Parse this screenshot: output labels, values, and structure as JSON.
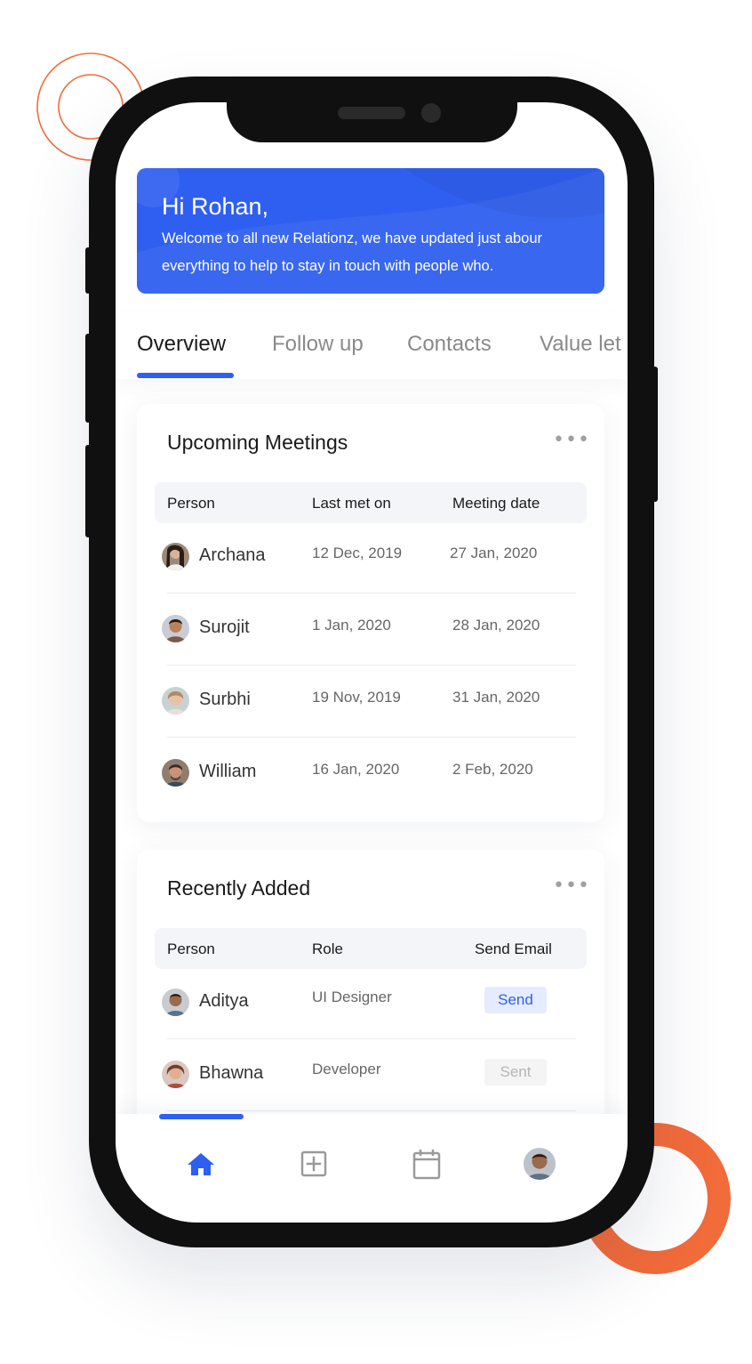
{
  "colors": {
    "accent": "#2f5ff0",
    "decor_orange": "#f26b3a",
    "phone_frame": "#101010"
  },
  "banner": {
    "greeting": "Hi Rohan,",
    "message": "Welcome to all new Relationz, we have updated just abour everything to help to stay in touch with people who."
  },
  "tabs": [
    {
      "label": "Overview",
      "active": true
    },
    {
      "label": "Follow up",
      "active": false
    },
    {
      "label": "Contacts",
      "active": false
    },
    {
      "label": "Value let",
      "active": false
    }
  ],
  "upcoming": {
    "title": "Upcoming Meetings",
    "more_icon": "more-horizontal-icon",
    "columns": [
      "Person",
      "Last met on",
      "Meeting date"
    ],
    "rows": [
      {
        "name": "Archana",
        "last_met": "12 Dec, 2019",
        "meeting": "27 Jan, 2020"
      },
      {
        "name": "Surojit",
        "last_met": "1 Jan, 2020",
        "meeting": "28 Jan, 2020"
      },
      {
        "name": "Surbhi",
        "last_met": "19 Nov, 2019",
        "meeting": "31 Jan, 2020"
      },
      {
        "name": "William",
        "last_met": "16 Jan, 2020",
        "meeting": "2 Feb, 2020"
      }
    ]
  },
  "recent": {
    "title": "Recently Added",
    "more_icon": "more-horizontal-icon",
    "columns": [
      "Person",
      "Role",
      "Send Email"
    ],
    "rows": [
      {
        "name": "Aditya",
        "role": "UI Designer",
        "action": "Send",
        "sent": false
      },
      {
        "name": "Bhawna",
        "role": "Developer",
        "action": "Sent",
        "sent": true
      }
    ]
  },
  "bottom_nav": {
    "items": [
      {
        "icon": "home-icon",
        "active": true
      },
      {
        "icon": "add-square-icon",
        "active": false
      },
      {
        "icon": "calendar-icon",
        "active": false
      },
      {
        "icon": "profile-avatar",
        "active": false
      }
    ]
  }
}
